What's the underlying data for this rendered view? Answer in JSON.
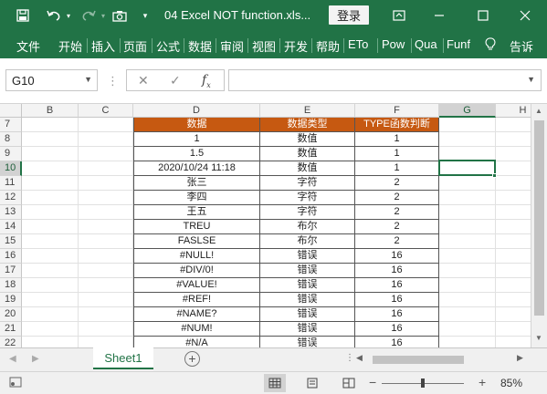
{
  "window": {
    "title": "04 Excel NOT function.xls...",
    "login_label": "登录"
  },
  "ribbon": {
    "tabs": [
      "文件",
      "开始",
      "插入",
      "页面",
      "公式",
      "数据",
      "审阅",
      "视图",
      "开发",
      "帮助",
      "ETo",
      "Pow",
      "Qua",
      "Funf",
      "告诉"
    ]
  },
  "formula_bar": {
    "name_box": "G10",
    "formula": ""
  },
  "grid": {
    "columns": [
      "B",
      "C",
      "D",
      "E",
      "F",
      "G",
      "H"
    ],
    "selected_column": "G",
    "rows": [
      "7",
      "8",
      "9",
      "10",
      "11",
      "12",
      "13",
      "14",
      "15",
      "16",
      "17",
      "18",
      "19",
      "20",
      "21",
      "22"
    ],
    "selected_row": "10",
    "header": [
      "数据",
      "数据类型",
      "TYPE函数判断"
    ],
    "data": [
      [
        "1",
        "数值",
        "1"
      ],
      [
        "1.5",
        "数值",
        "1"
      ],
      [
        "2020/10/24 11:18",
        "数值",
        "1"
      ],
      [
        "张三",
        "字符",
        "2"
      ],
      [
        "李四",
        "字符",
        "2"
      ],
      [
        "王五",
        "字符",
        "2"
      ],
      [
        "TREU",
        "布尔",
        "2"
      ],
      [
        "FASLSE",
        "布尔",
        "2"
      ],
      [
        "#NULL!",
        "错误",
        "16"
      ],
      [
        "#DIV/0!",
        "错误",
        "16"
      ],
      [
        "#VALUE!",
        "错误",
        "16"
      ],
      [
        "#REF!",
        "错误",
        "16"
      ],
      [
        "#NAME?",
        "错误",
        "16"
      ],
      [
        "#NUM!",
        "错误",
        "16"
      ],
      [
        "#N/A",
        "错误",
        "16"
      ]
    ]
  },
  "sheets": {
    "active": "Sheet1"
  },
  "status": {
    "zoom": "85%"
  },
  "colors": {
    "brand": "#217346",
    "table_header": "#c65911"
  }
}
